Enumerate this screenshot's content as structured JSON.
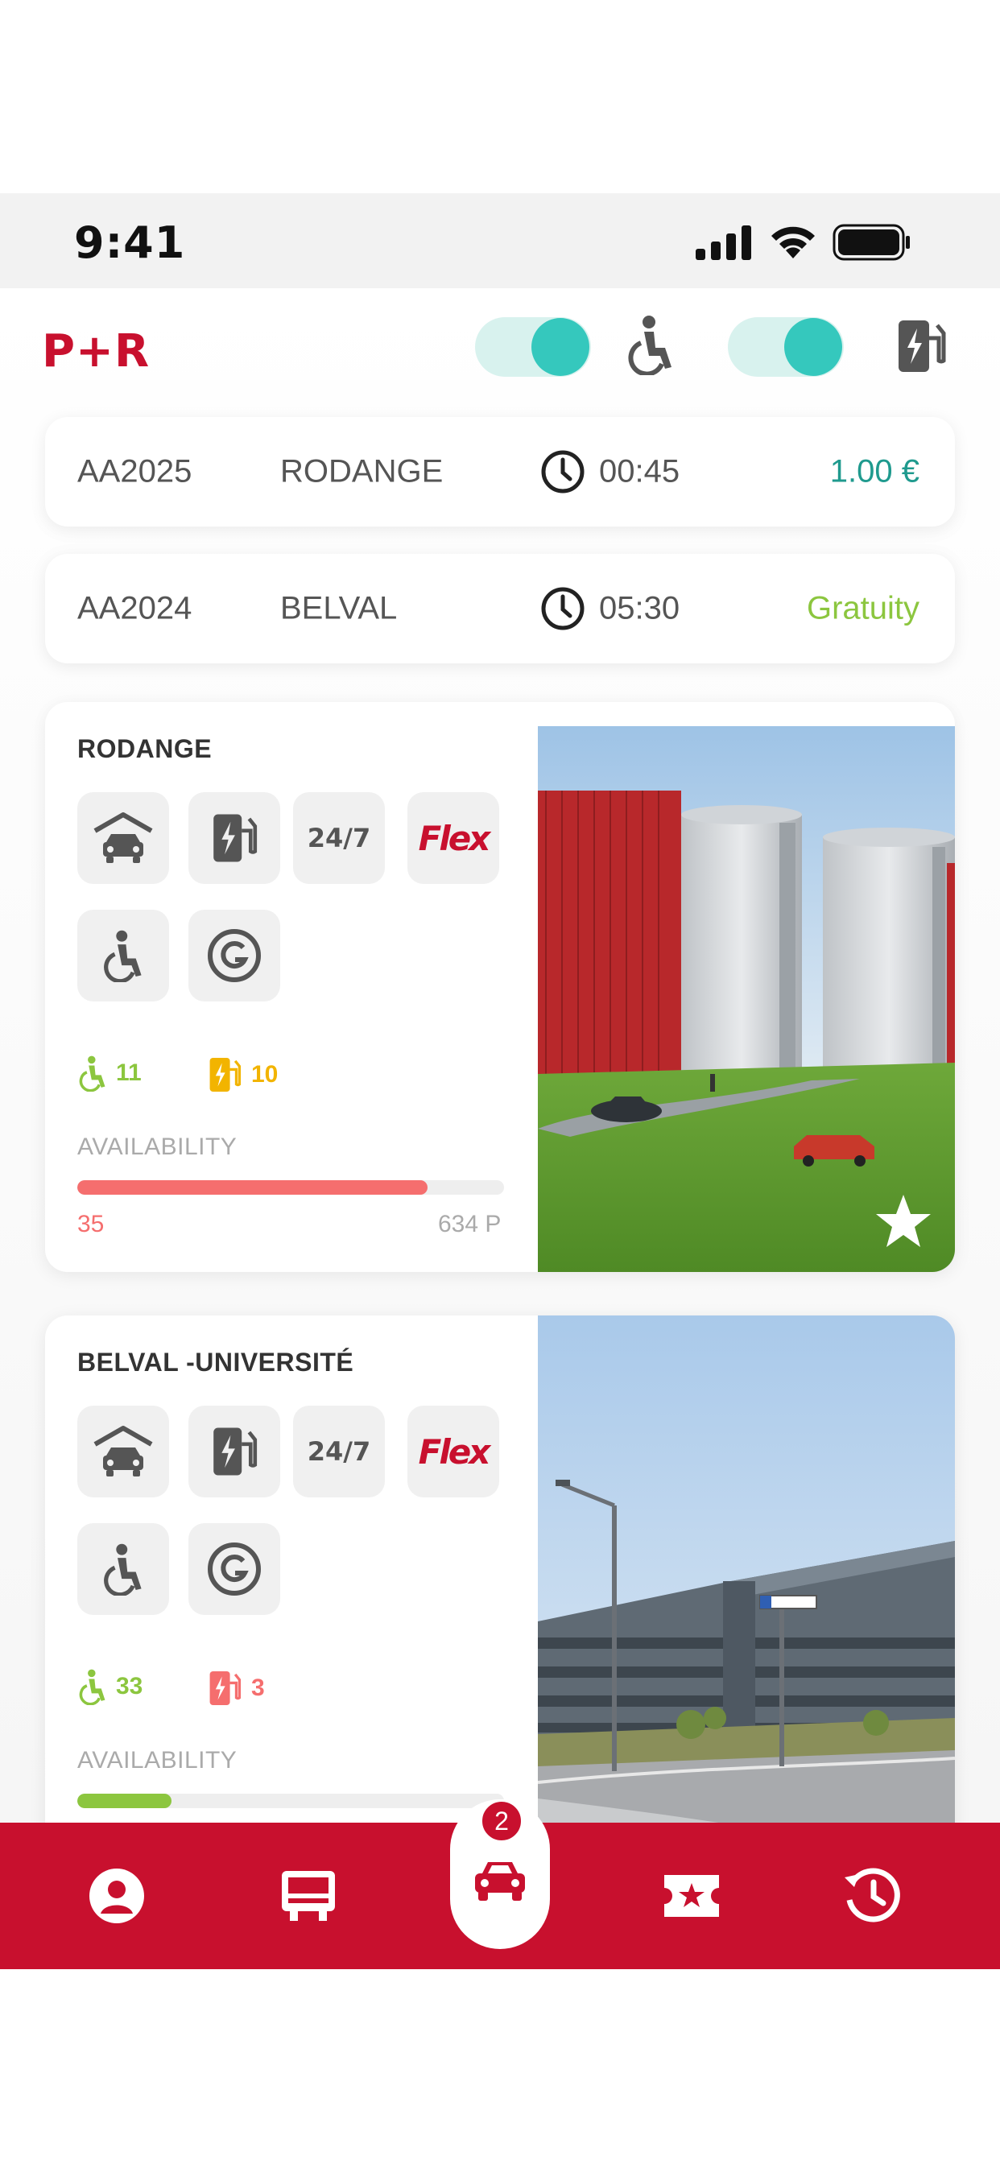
{
  "status_bar": {
    "time": "9:41"
  },
  "header": {
    "brand": "P+R",
    "accessible_filter_on": true,
    "charging_filter_on": true
  },
  "tickets": [
    {
      "plate": "AA2025",
      "location": "RODANGE",
      "duration": "00:45",
      "price": "1.00 €",
      "price_color": "#1f9a8e"
    },
    {
      "plate": "AA2024",
      "location": "BELVAL",
      "duration": "05:30",
      "price": "Gratuity",
      "price_color": "#8cc63f"
    }
  ],
  "parkings": [
    {
      "name": "RODANGE",
      "features": {
        "open_hours": "24/7",
        "flex": "Flex"
      },
      "accessible_count": "11",
      "charging_count": "10",
      "charging_color": "#f2b400",
      "availability_label": "AVAILABILITY",
      "occupancy_fraction": 0.82,
      "bar_color": "#f56e6e",
      "free": "35",
      "free_color": "#f56e6e",
      "capacity": "634 P",
      "favorite": true
    },
    {
      "name": "BELVAL -UNIVERSITÉ",
      "features": {
        "open_hours": "24/7",
        "flex": "Flex"
      },
      "accessible_count": "33",
      "charging_count": "3",
      "charging_color": "#f56e6e",
      "availability_label": "AVAILABILITY",
      "occupancy_fraction": 0.22,
      "bar_color": "#8cc63f",
      "free": "",
      "capacity": "",
      "favorite": false
    }
  ],
  "tabbar": {
    "items": [
      "profile-icon",
      "bus-icon",
      "car-icon",
      "ticket-star-icon",
      "history-icon"
    ],
    "active": "car-icon",
    "badge": "2"
  },
  "colors": {
    "brand": "#c8102e",
    "accent": "#35c8bd",
    "green": "#8cc63f"
  }
}
